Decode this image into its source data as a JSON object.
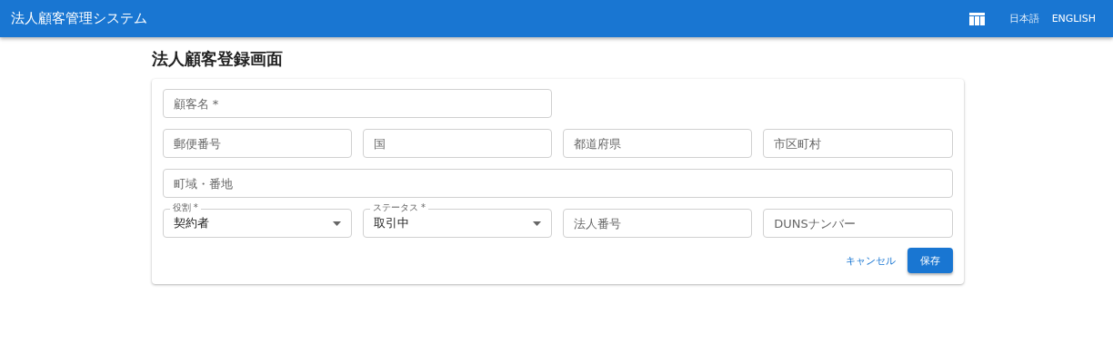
{
  "app_bar": {
    "title": "法人顧客管理システム",
    "languages": [
      {
        "label": "日本語",
        "selected": true
      },
      {
        "label": "ENGLISH",
        "selected": false
      }
    ]
  },
  "page_title": "法人顧客登録画面",
  "form": {
    "rows": [
      [
        {
          "kind": "text",
          "placeholder": "顧客名 *"
        }
      ],
      [
        {
          "kind": "text",
          "placeholder": "郵便番号"
        },
        {
          "kind": "text",
          "placeholder": "国"
        },
        {
          "kind": "text",
          "placeholder": "都道府県"
        },
        {
          "kind": "text",
          "placeholder": "市区町村"
        }
      ],
      [
        {
          "kind": "text",
          "placeholder": "町域・番地"
        }
      ],
      [
        {
          "kind": "select",
          "label": "役割 *",
          "value": "契約者"
        },
        {
          "kind": "select",
          "label": "ステータス *",
          "value": "取引中"
        },
        {
          "kind": "text",
          "placeholder": "法人番号"
        },
        {
          "kind": "text",
          "placeholder": "DUNSナンバー"
        }
      ]
    ],
    "cancel": "キャンセル",
    "save": "保存"
  }
}
